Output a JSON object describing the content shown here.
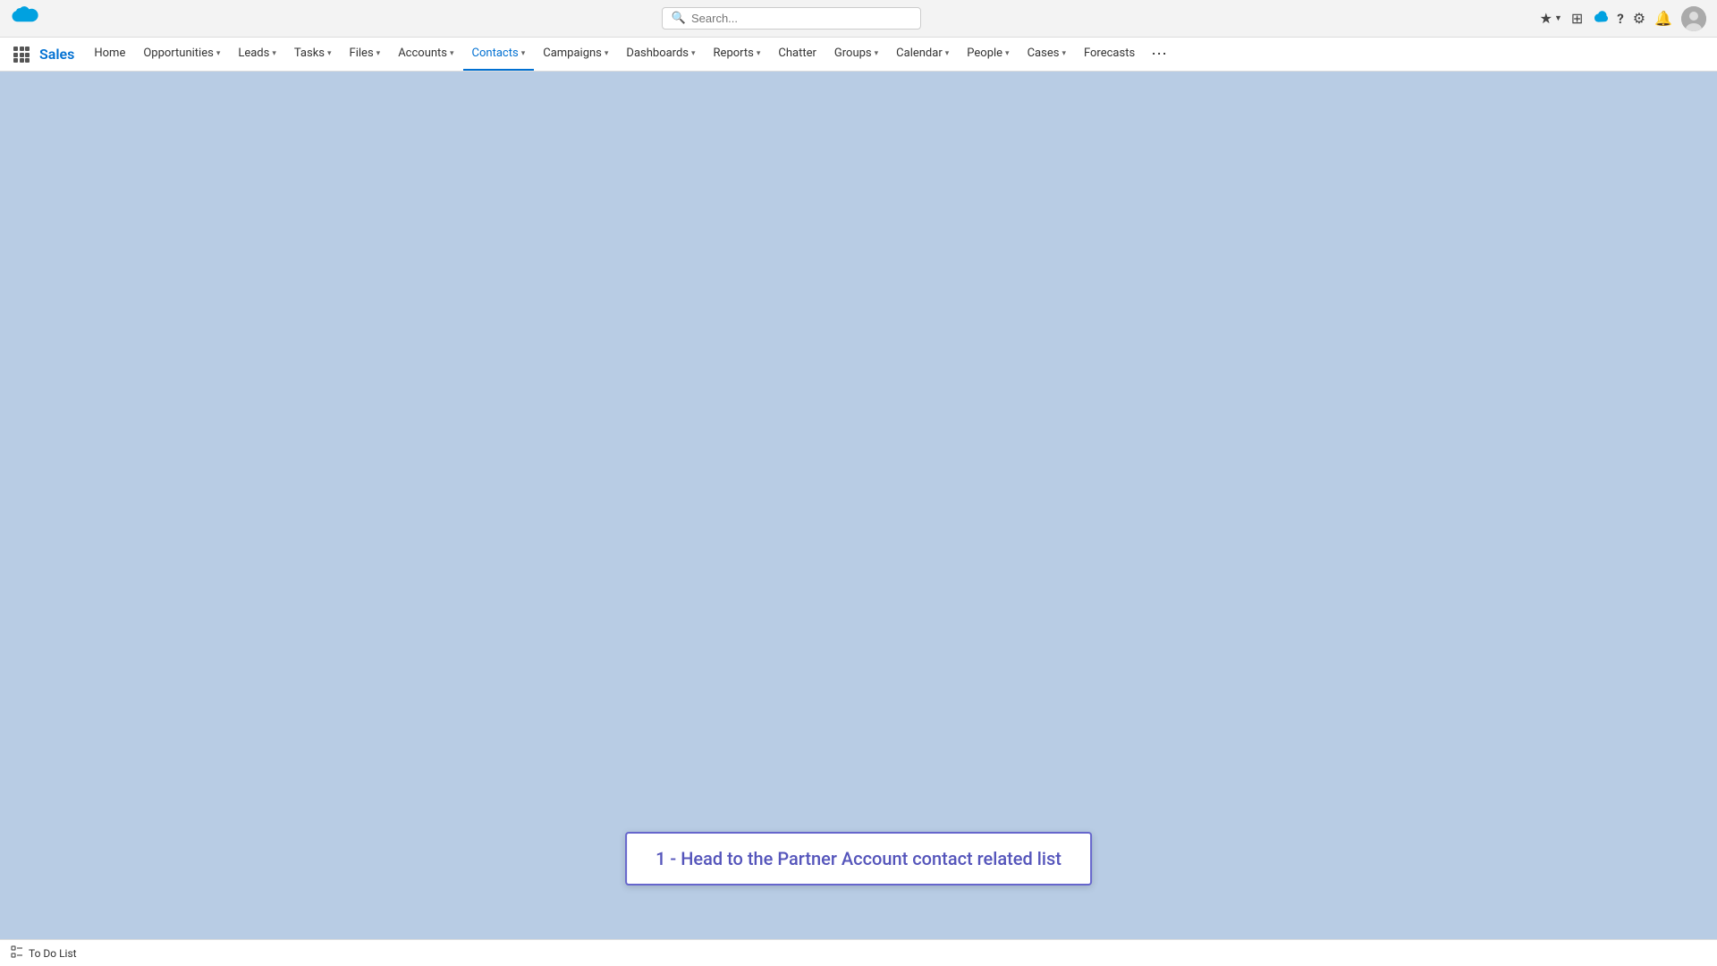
{
  "topbar": {
    "search_placeholder": "Search...",
    "logo_alt": "Salesforce"
  },
  "topbar_icons": {
    "favorites": "★",
    "waffle": "⊞",
    "cloud": "☁",
    "help": "?",
    "setup": "⚙",
    "notifications": "🔔"
  },
  "navbar": {
    "app_name": "Sales",
    "items": [
      {
        "label": "Home",
        "has_chevron": false,
        "active": false
      },
      {
        "label": "Opportunities",
        "has_chevron": true,
        "active": false
      },
      {
        "label": "Leads",
        "has_chevron": true,
        "active": false
      },
      {
        "label": "Tasks",
        "has_chevron": true,
        "active": false
      },
      {
        "label": "Files",
        "has_chevron": true,
        "active": false
      },
      {
        "label": "Accounts",
        "has_chevron": true,
        "active": false
      },
      {
        "label": "Contacts",
        "has_chevron": true,
        "active": true
      },
      {
        "label": "Campaigns",
        "has_chevron": true,
        "active": false
      },
      {
        "label": "Dashboards",
        "has_chevron": true,
        "active": false
      },
      {
        "label": "Reports",
        "has_chevron": true,
        "active": false
      },
      {
        "label": "Chatter",
        "has_chevron": false,
        "active": false
      },
      {
        "label": "Groups",
        "has_chevron": true,
        "active": false
      },
      {
        "label": "Calendar",
        "has_chevron": true,
        "active": false
      },
      {
        "label": "People",
        "has_chevron": true,
        "active": false
      },
      {
        "label": "Cases",
        "has_chevron": true,
        "active": false
      },
      {
        "label": "Forecasts",
        "has_chevron": false,
        "active": false
      }
    ]
  },
  "instruction": {
    "text": "1 - Head to the Partner Account contact related list"
  },
  "bottom_bar": {
    "todo_label": "To Do List"
  }
}
